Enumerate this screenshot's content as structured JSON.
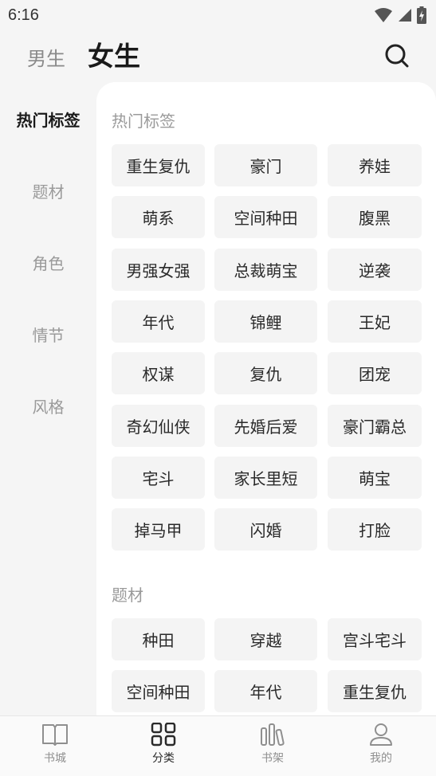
{
  "status": {
    "time": "6:16"
  },
  "header": {
    "male_label": "男生",
    "female_label": "女生"
  },
  "sidebar": {
    "items": [
      {
        "label": "热门标签",
        "active": true
      },
      {
        "label": "题材",
        "active": false
      },
      {
        "label": "角色",
        "active": false
      },
      {
        "label": "情节",
        "active": false
      },
      {
        "label": "风格",
        "active": false
      }
    ]
  },
  "sections": [
    {
      "title": "热门标签",
      "tags": [
        "重生复仇",
        "豪门",
        "养娃",
        "萌系",
        "空间种田",
        "腹黑",
        "男强女强",
        "总裁萌宝",
        "逆袭",
        "年代",
        "锦鲤",
        "王妃",
        "权谋",
        "复仇",
        "团宠",
        "奇幻仙侠",
        "先婚后爱",
        "豪门霸总",
        "宅斗",
        "家长里短",
        "萌宝",
        "掉马甲",
        "闪婚",
        "打脸"
      ]
    },
    {
      "title": "题材",
      "tags": [
        "种田",
        "穿越",
        "宫斗宅斗",
        "空间种田",
        "年代",
        "重生复仇"
      ]
    }
  ],
  "tabbar": {
    "items": [
      {
        "label": "书城",
        "icon": "book-open-icon",
        "active": false
      },
      {
        "label": "分类",
        "icon": "grid-icon",
        "active": true
      },
      {
        "label": "书架",
        "icon": "bookshelf-icon",
        "active": false
      },
      {
        "label": "我的",
        "icon": "user-icon",
        "active": false
      }
    ]
  },
  "colors": {
    "background": "#f5f5f5",
    "panel": "#ffffff",
    "tag_bg": "#f4f4f4",
    "muted_text": "#9a9a9a"
  }
}
